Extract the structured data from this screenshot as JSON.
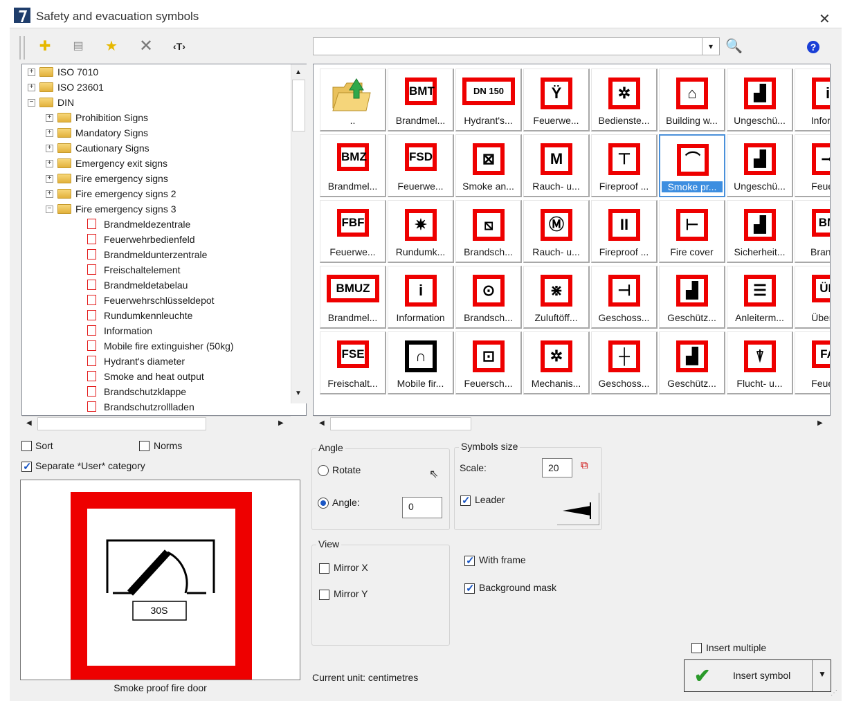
{
  "window": {
    "title": "Safety and evacuation symbols"
  },
  "toolbar": {
    "tools": [
      {
        "name": "add-category",
        "glyph": "✚"
      },
      {
        "name": "properties",
        "glyph": "▤"
      },
      {
        "name": "favorite",
        "glyph": "★"
      },
      {
        "name": "delete",
        "glyph": "✕"
      },
      {
        "name": "text-tag",
        "glyph": "‹T›"
      }
    ],
    "search_value": ""
  },
  "tree": {
    "items": [
      {
        "label": "ISO 7010",
        "level": 0,
        "kind": "folder",
        "exp": "+"
      },
      {
        "label": "ISO 23601",
        "level": 0,
        "kind": "folder",
        "exp": "+"
      },
      {
        "label": "DIN",
        "level": 0,
        "kind": "folder",
        "exp": "−"
      },
      {
        "label": "Prohibition Signs",
        "level": 1,
        "kind": "folder",
        "exp": "+"
      },
      {
        "label": "Mandatory Signs",
        "level": 1,
        "kind": "folder",
        "exp": "+"
      },
      {
        "label": "Cautionary Signs",
        "level": 1,
        "kind": "folder",
        "exp": "+"
      },
      {
        "label": "Emergency exit signs",
        "level": 1,
        "kind": "folder",
        "exp": "+"
      },
      {
        "label": "Fire emergency signs",
        "level": 1,
        "kind": "folder",
        "exp": "+"
      },
      {
        "label": "Fire emergency signs 2",
        "level": 1,
        "kind": "folder",
        "exp": "+"
      },
      {
        "label": "Fire emergency signs 3",
        "level": 1,
        "kind": "folder",
        "exp": "−"
      },
      {
        "label": "Brandmeldezentrale",
        "level": 2,
        "kind": "symbol"
      },
      {
        "label": "Feuerwehrbedienfeld",
        "level": 2,
        "kind": "symbol"
      },
      {
        "label": "Brandmeldunterzentrale",
        "level": 2,
        "kind": "symbol"
      },
      {
        "label": "Freischaltelement",
        "level": 2,
        "kind": "symbol"
      },
      {
        "label": "Brandmeldetabelau",
        "level": 2,
        "kind": "symbol"
      },
      {
        "label": "Feuerwehrschlüsseldepot",
        "level": 2,
        "kind": "symbol"
      },
      {
        "label": "Rundumkennleuchte",
        "level": 2,
        "kind": "symbol"
      },
      {
        "label": "Information",
        "level": 2,
        "kind": "symbol"
      },
      {
        "label": "Mobile fire extinguisher (50kg)",
        "level": 2,
        "kind": "symbol"
      },
      {
        "label": "Hydrant's diameter",
        "level": 2,
        "kind": "symbol"
      },
      {
        "label": "Smoke and heat output",
        "level": 2,
        "kind": "symbol"
      },
      {
        "label": "Brandschutzklappe",
        "level": 2,
        "kind": "symbol"
      },
      {
        "label": "Brandschutzrollladen",
        "level": 2,
        "kind": "symbol"
      }
    ]
  },
  "symbols": {
    "rows": [
      [
        {
          "caption": "..",
          "icon": "folder-up"
        },
        {
          "caption": "Brandmel...",
          "icon": "text",
          "text": "BMT"
        },
        {
          "caption": "Hydrant's...",
          "icon": "text",
          "text": "DN 150"
        },
        {
          "caption": "Feuerwe...",
          "icon": "glyph",
          "text": "Ÿ"
        },
        {
          "caption": "Bedienste...",
          "icon": "glyph",
          "text": "✲"
        },
        {
          "caption": "Building w...",
          "icon": "glyph",
          "text": "⌂"
        },
        {
          "caption": "Ungeschü...",
          "icon": "glyph",
          "text": "▟"
        },
        {
          "caption": "Informa",
          "icon": "glyph",
          "text": "i"
        }
      ],
      [
        {
          "caption": "Brandmel...",
          "icon": "text",
          "text": "BMZ"
        },
        {
          "caption": "Feuerwe...",
          "icon": "text",
          "text": "FSD"
        },
        {
          "caption": "Smoke an...",
          "icon": "glyph",
          "text": "⊠"
        },
        {
          "caption": "Rauch- u...",
          "icon": "glyph",
          "text": "M"
        },
        {
          "caption": "Fireproof ...",
          "icon": "glyph",
          "text": "⊤"
        },
        {
          "caption": "Smoke pr...",
          "icon": "glyph",
          "text": "⌒",
          "selected": true
        },
        {
          "caption": "Ungeschü...",
          "icon": "glyph",
          "text": "▟"
        },
        {
          "caption": "Feuerw",
          "icon": "glyph",
          "text": "⊸"
        }
      ],
      [
        {
          "caption": "Feuerwe...",
          "icon": "text",
          "text": "FBF"
        },
        {
          "caption": "Rundumk...",
          "icon": "glyph",
          "text": "✷"
        },
        {
          "caption": "Brandsch...",
          "icon": "glyph",
          "text": "⧅"
        },
        {
          "caption": "Rauch- u...",
          "icon": "glyph",
          "text": "Ⓜ"
        },
        {
          "caption": "Fireproof ...",
          "icon": "glyph",
          "text": "II"
        },
        {
          "caption": "Fire cover",
          "icon": "glyph",
          "text": "⊢"
        },
        {
          "caption": "Sicherheit...",
          "icon": "glyph",
          "text": "▟"
        },
        {
          "caption": "Brandm",
          "icon": "text",
          "text": "BM"
        }
      ],
      [
        {
          "caption": "Brandmel...",
          "icon": "text",
          "text": "BMUZ"
        },
        {
          "caption": "Information",
          "icon": "glyph",
          "text": "i"
        },
        {
          "caption": "Brandsch...",
          "icon": "glyph",
          "text": "⊙"
        },
        {
          "caption": "Zuluftöff...",
          "icon": "glyph",
          "text": "⋇"
        },
        {
          "caption": "Geschoss...",
          "icon": "glyph",
          "text": "⊣"
        },
        {
          "caption": "Geschütz...",
          "icon": "glyph",
          "text": "▟"
        },
        {
          "caption": "Anleiterm...",
          "icon": "glyph",
          "text": "☰"
        },
        {
          "caption": "Übertra",
          "icon": "text",
          "text": "ÜE"
        }
      ],
      [
        {
          "caption": "Freischalt...",
          "icon": "text",
          "text": "FSE"
        },
        {
          "caption": "Mobile fir...",
          "icon": "glyph-black",
          "text": "∩"
        },
        {
          "caption": "Feuersch...",
          "icon": "glyph",
          "text": "⊡"
        },
        {
          "caption": "Mechanis...",
          "icon": "glyph",
          "text": "✲"
        },
        {
          "caption": "Geschoss...",
          "icon": "glyph",
          "text": "┼"
        },
        {
          "caption": "Geschütz...",
          "icon": "glyph",
          "text": "▟"
        },
        {
          "caption": "Flucht- u...",
          "icon": "glyph",
          "text": "⍒"
        },
        {
          "caption": "Feuerw",
          "icon": "text",
          "text": "FA"
        }
      ]
    ]
  },
  "options": {
    "sort_label": "Sort",
    "sort_checked": false,
    "norms_label": "Norms",
    "norms_checked": false,
    "separate_user_label": "Separate *User* category",
    "separate_user_checked": true
  },
  "preview": {
    "caption": "Smoke proof fire door",
    "sign_text": "30S",
    "colors": {
      "frame": "#ee0000",
      "ink": "#000000"
    }
  },
  "angle": {
    "title": "Angle",
    "rotate_label": "Rotate",
    "angle_label": "Angle:",
    "angle_value": "0",
    "selected": "angle"
  },
  "size": {
    "title": "Symbols size",
    "scale_label": "Scale:",
    "scale_value": "20",
    "leader_label": "Leader",
    "leader_checked": true
  },
  "view": {
    "title": "View",
    "mirror_x_label": "Mirror X",
    "mirror_x_checked": false,
    "mirror_y_label": "Mirror Y",
    "mirror_y_checked": false
  },
  "frame": {
    "with_frame_label": "With frame",
    "with_frame_checked": true,
    "background_mask_label": "Background mask",
    "background_mask_checked": true
  },
  "footer": {
    "current_unit": "Current unit: centimetres",
    "insert_multiple_label": "Insert multiple",
    "insert_multiple_checked": false,
    "insert_button_label": "Insert symbol"
  },
  "colors": {
    "accent": "#3d8ee0",
    "sign_red": "#ee0000",
    "check": "#1a56c4"
  }
}
